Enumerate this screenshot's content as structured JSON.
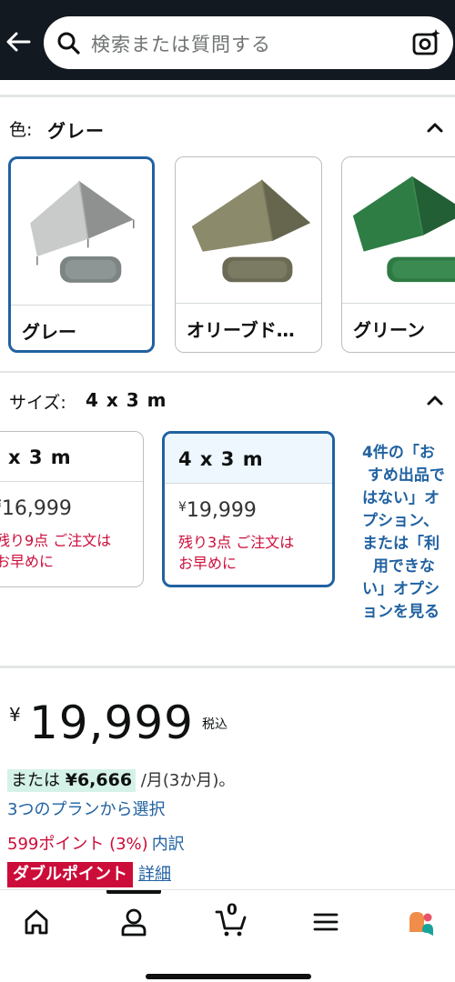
{
  "search": {
    "placeholder": "検索または質問する"
  },
  "color": {
    "label": "色:",
    "selected": "グレー",
    "options": [
      {
        "name": "グレー",
        "swatch": "#9ea09f",
        "bag": "#7c8583"
      },
      {
        "name": "オリーブド…",
        "swatch": "#76745a",
        "bag": "#6b6a55"
      },
      {
        "name": "グリーン",
        "swatch": "#2e7d45",
        "bag": "#2f7a44"
      }
    ]
  },
  "size": {
    "label": "サイズ:",
    "selected": "4 x 3 m",
    "options": [
      {
        "name": "x 3 m",
        "price_yen": "¥",
        "price": "16,999",
        "stock": "残り9点 ご注文は\nお早めに"
      },
      {
        "name": "4 x 3 m",
        "price_yen": "¥",
        "price": "19,999",
        "stock": "残り3点 ご注文は\nお早めに"
      }
    ],
    "more_link": "4件の「お\n すめ出品で\nはない」オ\nプション、\nまたは「利\n  用できな\nい」オプシ\nョンを見る"
  },
  "price": {
    "currency": "¥",
    "value": "19,999",
    "tax": "税込"
  },
  "installment": {
    "prefix": "または",
    "amount": "¥6,666",
    "suffix": " /月(3か月)。"
  },
  "plans_link": "3つのプランから選択",
  "points": {
    "text": "599ポイント (3%)",
    "breakdown": "内訳"
  },
  "double_points": {
    "badge": "ダブルポイント",
    "details": "詳細"
  },
  "nav": {
    "cart_count": "0",
    "items": [
      "home-icon",
      "account-icon",
      "cart-icon",
      "menu-icon",
      "rufus-icon"
    ]
  },
  "colors": {
    "accent": "#2162a1",
    "alert": "#cc0c39",
    "header": "#131921"
  }
}
